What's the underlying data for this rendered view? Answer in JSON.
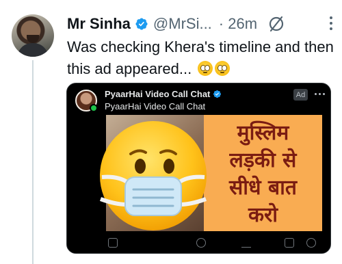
{
  "tweet": {
    "author_name": "Mr Sinha",
    "handle": "@MrSi...",
    "time": "· 26m",
    "text": "Was checking Khera's timeline and then this ad appeared...",
    "inline_emojis": [
      "face-with-rolling-eyes",
      "face-with-rolling-eyes"
    ]
  },
  "ad": {
    "title": "PyaarHai Video Call Chat",
    "subtitle": "PyaarHai Video Call Chat",
    "badge": "Ad",
    "banner_lines": [
      "मुस्लिम",
      "लड़की से",
      "सीधे बात",
      "करो"
    ]
  },
  "overlay": {
    "emoji": "face-with-medical-mask"
  },
  "colors": {
    "verified_blue": "#1d9bf0",
    "banner_orange": "#f9ac52",
    "banner_text": "#7a1c12",
    "live_green": "#1ec34a"
  }
}
